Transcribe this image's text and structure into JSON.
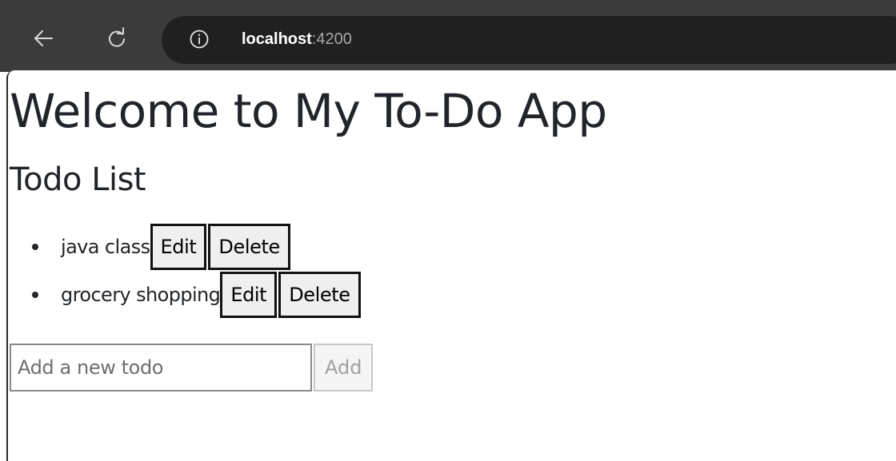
{
  "browser": {
    "url_host": "localhost",
    "url_port": ":4200",
    "icons": {
      "back": "arrow-left",
      "reload": "reload",
      "info": "info-circle"
    }
  },
  "page": {
    "title": "Welcome to My To-Do App",
    "subtitle": "Todo List",
    "todos": [
      {
        "text": "java class",
        "edit_label": "Edit",
        "delete_label": "Delete"
      },
      {
        "text": "grocery shopping",
        "edit_label": "Edit",
        "delete_label": "Delete"
      }
    ],
    "new_todo": {
      "value": "",
      "placeholder": "Add a new todo",
      "add_label": "Add"
    }
  }
}
